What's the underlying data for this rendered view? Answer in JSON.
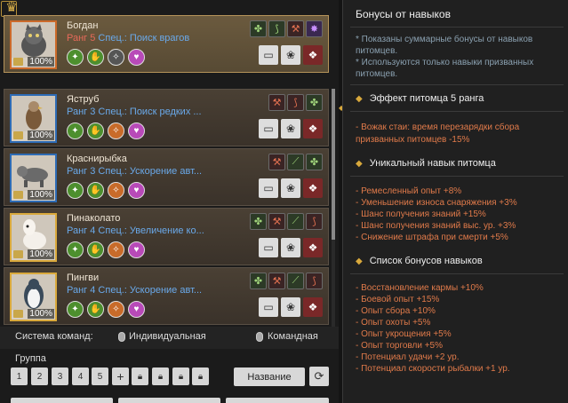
{
  "pets": [
    {
      "name": "Богдан",
      "rank": "Ранг 5",
      "spec": "Спец.: Поиск врагов",
      "percent": "100%"
    },
    {
      "name": "Яструб",
      "rank": "Ранг 3",
      "spec": "Спец.: Поиск редких ...",
      "percent": "100%"
    },
    {
      "name": "Краснирыбка",
      "rank": "Ранг 3",
      "spec": "Спец.: Ускорение авт...",
      "percent": "100%"
    },
    {
      "name": "Пинаколато",
      "rank": "Ранг 4",
      "spec": "Спец.: Увеличение ко...",
      "percent": "100%"
    },
    {
      "name": "Пингви",
      "rank": "Ранг 4",
      "spec": "Спец.: Ускорение авт...",
      "percent": "100%"
    }
  ],
  "command_system": {
    "label": "Система команд:",
    "option_individual": "Индивидуальная",
    "option_team": "Командная"
  },
  "group": {
    "label": "Группа",
    "slots": [
      "1",
      "2",
      "3",
      "4",
      "5",
      "+"
    ],
    "name_button": "Название"
  },
  "bonus_panel": {
    "title": "Бонусы от навыков",
    "note1": "* Показаны суммарные бонусы от навыков питомцев.",
    "note2": "* Используются только навыки призванных питомцев.",
    "section1": {
      "title": "Эффект питомца 5 ранга",
      "lines": [
        "- Вожак стаи: время перезарядки сбора",
        "призванных питомцев -15%"
      ]
    },
    "section2": {
      "title": "Уникальный навык питомца",
      "lines": [
        "- Ремесленный опыт +8%",
        "- Уменьшение износа снаряжения +3%",
        "- Шанс получения знаний +15%",
        "- Шанс получения знаний выс. ур. +3%",
        "- Снижение штрафа при смерти +5%"
      ]
    },
    "section3": {
      "title": "Список бонусов навыков",
      "lines": [
        "- Восстановление кармы +10%",
        "- Боевой опыт +15%",
        "- Опыт сбора +10%",
        "- Опыт охоты +5%",
        "- Опыт укрощения +5%",
        "- Опыт торговли +5%",
        "- Потенциал удачи +2 ур.",
        "- Потенциал скорости рыбалки +1 ур."
      ]
    }
  },
  "colors": {
    "rank5": "#e76a5a",
    "rank_other": "#6aa9ea",
    "bonus_text": "#e07a4a",
    "accent_gold": "#d9a93c"
  },
  "icons": [
    "crown-icon",
    "paw-icon",
    "feed-icon",
    "gift-icon",
    "mouse-icon",
    "refresh-icon",
    "lock-icon"
  ]
}
